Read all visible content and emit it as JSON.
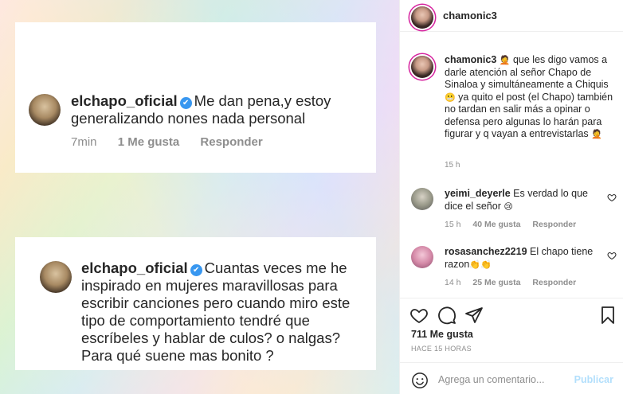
{
  "image": {
    "card1": {
      "username": "elchapo_oficial",
      "text": "Me dan pena,y estoy generalizando nones nada personal",
      "time": "7min",
      "likes": "1 Me gusta",
      "reply": "Responder"
    },
    "card2": {
      "username": "elchapo_oficial",
      "text": "Cuantas veces  me he inspirado en mujeres maravillosas para escribir canciones pero cuando miro este tipo de comportamiento tendré que escríbeles y  hablar de culos? o nalgas? Para qué suene mas bonito ?"
    }
  },
  "header": {
    "username": "chamonic3"
  },
  "caption": {
    "username": "chamonic3",
    "text_1": " que les digo vamos a darle atención al señor Chapo de Sinaloa y simultáneamente a Chiquis ",
    "text_2": " ya quito el post (el Chapo) también no tardan en salir más a opinar o defensa pero algunas lo harán para figurar y q vayan a entrevistarlas ",
    "emoji_1": "🤦",
    "emoji_2": "😬",
    "emoji_3": "🤦",
    "time": "15 h"
  },
  "comments": [
    {
      "username": "yeimi_deyerle",
      "text": " Es verdad lo que dice el señor ",
      "emoji": "😢",
      "time": "15 h",
      "likes": "40 Me gusta",
      "reply": "Responder"
    },
    {
      "username": "rosasanchez2219",
      "text": " El chapo tiene razon",
      "emoji": "👏👏",
      "time": "14 h",
      "likes": "25 Me gusta",
      "reply": "Responder"
    }
  ],
  "post": {
    "likes": "711 Me gusta",
    "ago": "HACE 15 HORAS"
  },
  "comment_box": {
    "placeholder": "Agrega un comentario...",
    "post_label": "Publicar"
  },
  "colors": {
    "link_blue": "#3897f0",
    "publish_disabled": "#b2dffc",
    "ring": "#d6249f"
  }
}
